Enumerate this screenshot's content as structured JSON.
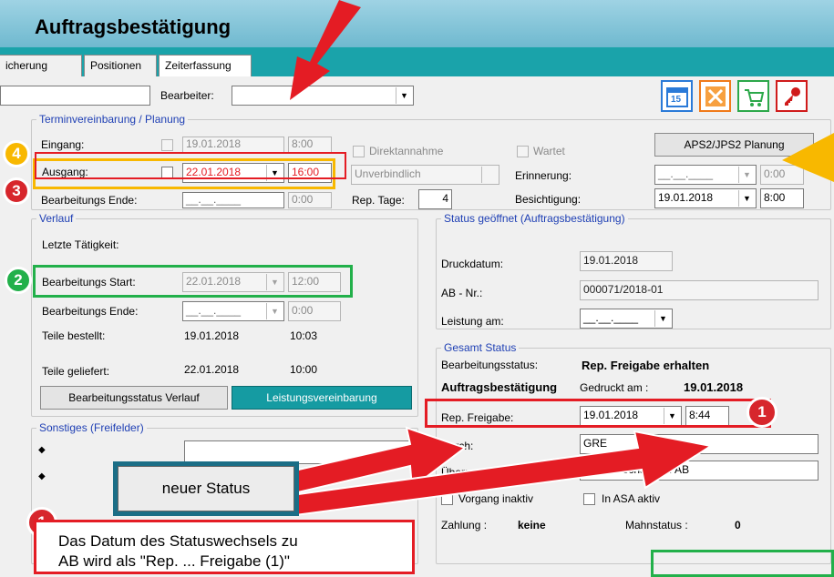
{
  "window": {
    "title": "Auftragsbestätigung"
  },
  "tabs": [
    "icherung",
    "Positionen",
    "Zeiterfassung"
  ],
  "header": {
    "bearbeiter_label": "Bearbeiter:",
    "bearbeiter_value": "",
    "left_field_value": ""
  },
  "toolbar_icons": [
    "calendar-15-icon",
    "tools-icon",
    "cart-icon",
    "key-icon"
  ],
  "termin": {
    "title": "Terminvereinbarung / Planung",
    "eingang_label": "Eingang:",
    "eingang_date": "19.01.2018",
    "eingang_time": "8:00",
    "ausgang_label": "Ausgang:",
    "ausgang_date": "22.01.2018",
    "ausgang_time": "16:00",
    "ende_label": "Bearbeitungs Ende:",
    "ende_date": "__.__.____",
    "ende_time": "0:00",
    "direktannahme_label": "Direktannahme",
    "unverbindlich_value": "Unverbindlich",
    "rep_tage_label": "Rep. Tage:",
    "rep_tage_value": "4",
    "wartet_label": "Wartet",
    "erinnerung_label": "Erinnerung:",
    "erinnerung_date": "__.__.____",
    "erinnerung_time": "0:00",
    "besichtigung_label": "Besichtigung:",
    "besichtigung_date": "19.01.2018",
    "besichtigung_time": "8:00",
    "aps_button": "APS2/JPS2 Planung"
  },
  "verlauf": {
    "title": "Verlauf",
    "letzte_label": "Letzte Tätigkeit:",
    "start_label": "Bearbeitungs Start:",
    "start_date": "22.01.2018",
    "start_time": "12:00",
    "ende_label": "Bearbeitungs Ende:",
    "ende_date": "__.__.____",
    "ende_time": "0:00",
    "bestellt_label": "Teile bestellt:",
    "bestellt_date": "19.01.2018",
    "bestellt_time": "10:03",
    "geliefert_label": "Teile geliefert:",
    "geliefert_date": "22.01.2018",
    "geliefert_time": "10:00",
    "verlauf_button": "Bearbeitungsstatus Verlauf",
    "leistung_button": "Leistungsvereinbarung"
  },
  "status": {
    "title": "Status geöffnet (Auftragsbestätigung)",
    "druckdatum_label": "Druckdatum:",
    "druckdatum_value": "19.01.2018",
    "ab_label": "AB - Nr.:",
    "ab_value": "000071/2018-01",
    "leistung_label": "Leistung am:",
    "leistung_value": "__.__.____"
  },
  "gesamt": {
    "title": "Gesamt Status",
    "bearbeitungsstatus_label": "Bearbeitungsstatus:",
    "bearbeitungsstatus_value": "Rep. Freigabe erhalten",
    "ab_label": "Auftragsbestätigung",
    "gedruckt_label": "Gedruckt am :",
    "gedruckt_value": "19.01.2018",
    "freigabe_label": "Rep. Freigabe:",
    "freigabe_date": "19.01.2018",
    "freigabe_time": "8:44",
    "durch_label": "Durch:",
    "durch_value": "GRE",
    "ueber_label": "Über:",
    "ueber_value": "Statuswechsel auf AB",
    "inaktiv_label": "Vorgang inaktiv",
    "asa_label": "In ASA aktiv",
    "zahlung_label": "Zahlung :",
    "zahlung_value": "keine",
    "mahnstatus_label": "Mahnstatus :",
    "mahnstatus_value": "0"
  },
  "sonstiges": {
    "title": "Sonstiges (Freifelder)"
  },
  "overlay": {
    "neuer_status_button": "neuer Status",
    "note_text": "Das Datum des Statuswechsels zu",
    "note_text_2": "AB wird als \"Rep. ... Freigabe (1)\"",
    "callouts": [
      "1",
      "2",
      "3",
      "4",
      "1",
      "1"
    ]
  },
  "colors": {
    "red": "#e41c24",
    "green": "#22b04a",
    "orange": "#f8b800",
    "teal": "#1aa3aa",
    "blue_label": "#1e3fb4"
  }
}
